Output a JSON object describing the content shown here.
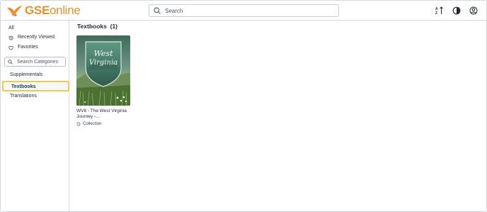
{
  "brand": {
    "name_bold": "GSE",
    "name_light": "online",
    "color": "#e8912c"
  },
  "header": {
    "search_placeholder": "Search",
    "icons": [
      "sort-az-icon",
      "contrast-icon",
      "user-account-icon"
    ]
  },
  "sidebar": {
    "top_items": [
      {
        "label": "All",
        "icon": ""
      },
      {
        "label": "Recently Viewed",
        "icon": "history-icon"
      },
      {
        "label": "Favorites",
        "icon": "heart-icon"
      }
    ],
    "category_search_placeholder": "Search Categories",
    "categories": [
      {
        "label": "Supplementals",
        "selected": false
      },
      {
        "label": "Textbooks",
        "selected": true
      },
      {
        "label": "Translations",
        "selected": false
      }
    ],
    "selected_highlight_color": "#f2c94c"
  },
  "main": {
    "heading": "Textbooks",
    "count": "(1)",
    "items": [
      {
        "cover_line1": "West",
        "cover_line2": "Virginia",
        "title": "WV8 - The West Virginia Journey -...",
        "type": "Collection"
      }
    ]
  }
}
